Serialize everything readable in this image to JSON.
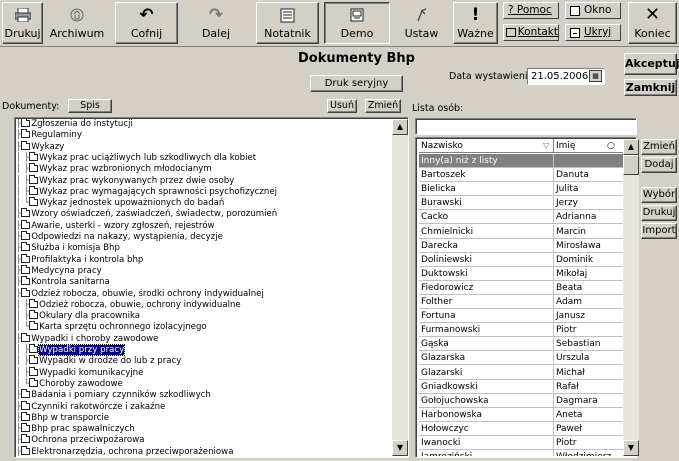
{
  "toolbar": {
    "print": "Drukuj",
    "archive": "Archiwum",
    "undo": "Cofnij",
    "redo": "Dalej",
    "notebook": "Notatnik",
    "demo": "Demo",
    "settings": "Ustaw",
    "important": "Ważne",
    "help": "? Pomoc",
    "contact": "Kontakt",
    "window": "Okno",
    "hide": "Ukryj",
    "end": "Koniec"
  },
  "header": {
    "title": "Dokumenty Bhp",
    "serial_print": "Druk seryjny",
    "issue_date_label": "Data wystawienia:",
    "issue_date": "21.05.2006",
    "accept": "Akceptuj",
    "close": "Zamknij"
  },
  "documents": {
    "label": "Dokumenty:",
    "list_button": "Spis",
    "delete": "Usuń",
    "change": "Zmień",
    "tree": [
      {
        "lead": "├",
        "label": "Zgłoszenia do instytucji"
      },
      {
        "lead": "├",
        "label": "Regulaminy"
      },
      {
        "lead": "├",
        "label": "Wykazy"
      },
      {
        "lead": "│ ├",
        "label": "Wykaz prac uciążliwych lub szkodliwych dla kobiet"
      },
      {
        "lead": "│ ├",
        "label": "Wykaz prac wzbronionych młodocianym"
      },
      {
        "lead": "│ ├",
        "label": "Wykaz prac wykonywanych przez dwie osoby"
      },
      {
        "lead": "│ ├",
        "label": "Wykaz prac wymagających sprawności psychofizycznej"
      },
      {
        "lead": "│ └",
        "label": "Wykaz jednostek upoważnionych do badań"
      },
      {
        "lead": "├",
        "label": "Wzory oświadczeń, zaświadczeń, świadectw, porozumień"
      },
      {
        "lead": "├",
        "label": "Awarie, usterki - wzory zgłoszeń, rejestrów"
      },
      {
        "lead": "├",
        "label": "Odpowiedzi na nakazy, wystąpienia, decyzje"
      },
      {
        "lead": "├",
        "label": "Służba i komisja Bhp"
      },
      {
        "lead": "├",
        "label": "Profilaktyka i kontrola bhp"
      },
      {
        "lead": "├",
        "label": "Medycyna pracy"
      },
      {
        "lead": "├",
        "label": "Kontrola sanitarna"
      },
      {
        "lead": "├",
        "label": "Odzież robocza, obuwie, środki ochrony indywidualnej"
      },
      {
        "lead": "│ ├",
        "label": "Odzież robocza, obuwie, ochrony indywidualne"
      },
      {
        "lead": "│ ├",
        "label": "Okulary dla pracownika"
      },
      {
        "lead": "│ └",
        "label": "Karta sprzętu ochronnego izolacyjnego"
      },
      {
        "lead": "├",
        "label": "Wypadki i choroby zawodowe"
      },
      {
        "lead": "│ ├",
        "label": "Wypadki przy pracy"
      },
      {
        "lead": "│ ├",
        "label": "Wypadki w drodze do lub z pracy"
      },
      {
        "lead": "│ ├",
        "label": "Wypadki komunikacyjne"
      },
      {
        "lead": "│ └",
        "label": "Choroby zawodowe"
      },
      {
        "lead": "├",
        "label": "Badania i pomiary czynników szkodliwych"
      },
      {
        "lead": "├",
        "label": "Czynniki rakotwórcze i zakaźne"
      },
      {
        "lead": "├",
        "label": "Bhp w transporcie"
      },
      {
        "lead": "├",
        "label": "Bhp prac spawalniczych"
      },
      {
        "lead": "├",
        "label": "Ochrona przeciwpożarowa"
      },
      {
        "lead": "├",
        "label": "Elektronarzędzia, ochrona przeciwporażeniowa"
      }
    ]
  },
  "persons": {
    "label": "Lista osób:",
    "col_surname": "Nazwisko",
    "col_name": "Imię",
    "rows": [
      {
        "surname": "Inny(a) niż z listy",
        "name": ""
      },
      {
        "surname": "Bartoszek",
        "name": "Danuta"
      },
      {
        "surname": "Bielicka",
        "name": "Julita"
      },
      {
        "surname": "Burawski",
        "name": "Jerzy"
      },
      {
        "surname": "Cacko",
        "name": "Adrianna"
      },
      {
        "surname": "Chmielnicki",
        "name": "Marcin"
      },
      {
        "surname": "Darecka",
        "name": "Mirosława"
      },
      {
        "surname": "Doliniewski",
        "name": "Dominik"
      },
      {
        "surname": "Duktowski",
        "name": "Mikołaj"
      },
      {
        "surname": "Fiedorowicz",
        "name": "Beata"
      },
      {
        "surname": "Folther",
        "name": "Adam"
      },
      {
        "surname": "Fortuna",
        "name": "Janusz"
      },
      {
        "surname": "Furmanowski",
        "name": "Piotr"
      },
      {
        "surname": "Gąska",
        "name": "Sebastian"
      },
      {
        "surname": "Glazarska",
        "name": "Urszula"
      },
      {
        "surname": "Glazarski",
        "name": "Michał"
      },
      {
        "surname": "Gniadkowski",
        "name": "Rafał"
      },
      {
        "surname": "Gołojuchowska",
        "name": "Dagmara"
      },
      {
        "surname": "Harbonowska",
        "name": "Aneta"
      },
      {
        "surname": "Hołowczyc",
        "name": "Paweł"
      },
      {
        "surname": "Iwanocki",
        "name": "Piotr"
      },
      {
        "surname": "Jamroziński",
        "name": "Włodzimierz"
      }
    ],
    "buttons": {
      "change": "Zmień",
      "add": "Dodaj",
      "select": "Wybór",
      "print": "Drukuj",
      "import": "Import"
    }
  }
}
